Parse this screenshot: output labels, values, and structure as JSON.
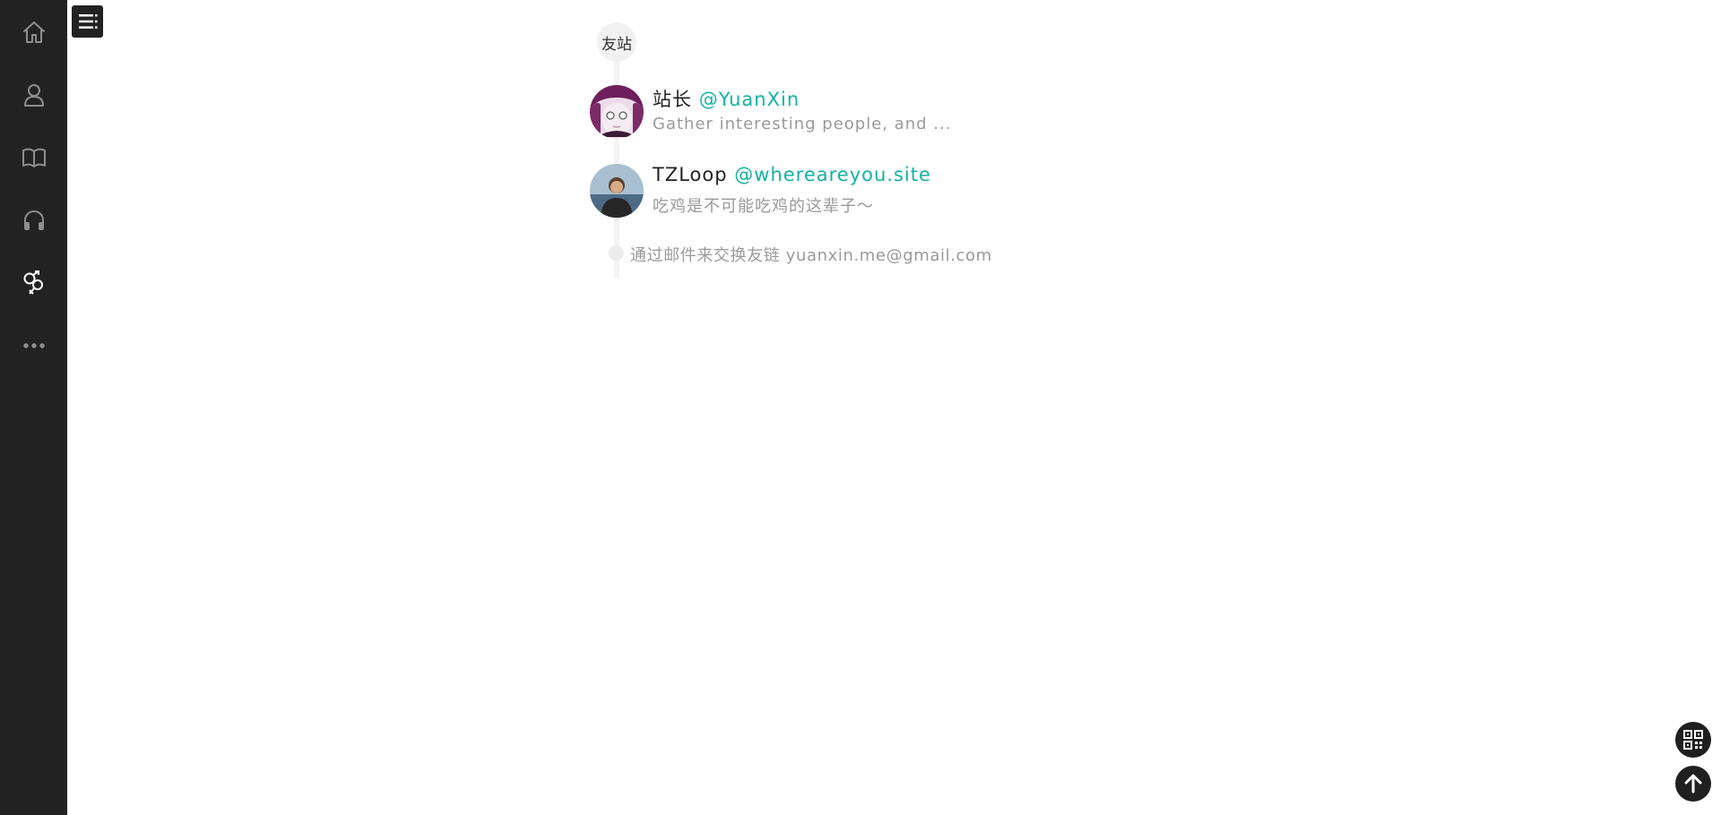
{
  "sidebar": {
    "items": [
      {
        "icon": "home-icon"
      },
      {
        "icon": "user-icon"
      },
      {
        "icon": "book-icon"
      },
      {
        "icon": "headphones-icon"
      },
      {
        "icon": "gender-icon"
      },
      {
        "icon": "more-icon"
      }
    ]
  },
  "toc": {
    "icon": "list-icon"
  },
  "section": {
    "label": "友站"
  },
  "friends": [
    {
      "name": "站长",
      "link": "@YuanXin",
      "description": "Gather interesting people, and ..."
    },
    {
      "name": "TZLoop",
      "link": "@whereareyou.site",
      "description": "吃鸡是不可能吃鸡的这辈子～"
    }
  ],
  "contact": {
    "text": "通过邮件来交换友链 yuanxin.me@gmail.com"
  },
  "floating": {
    "qr_icon": "qr-code-icon",
    "top_icon": "arrow-up-icon"
  },
  "colors": {
    "sidebar_bg": "#222222",
    "accent": "#14b2a3",
    "muted_text": "#9a9a9a"
  }
}
